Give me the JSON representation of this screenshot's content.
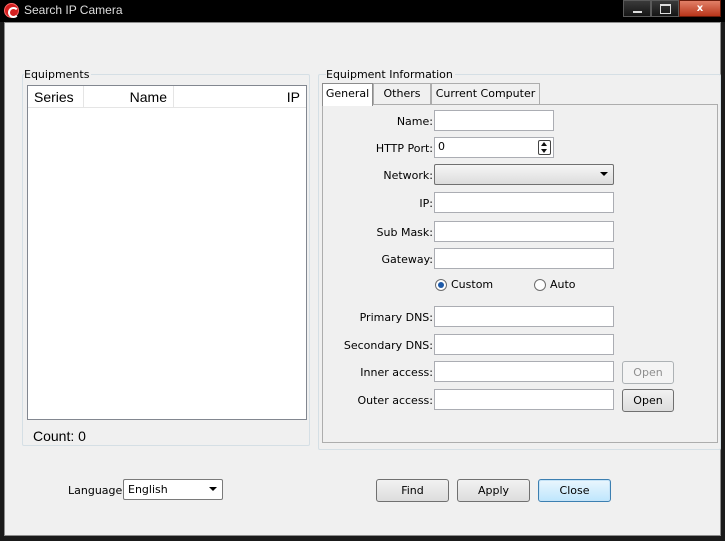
{
  "window": {
    "title": "Search IP Camera",
    "controls": {
      "minimize": "",
      "maximize": "",
      "close": "x"
    }
  },
  "equipments": {
    "group_title": "Equipments",
    "columns": [
      "Series",
      "Name",
      "IP"
    ],
    "rows": [],
    "count_text": "Count: 0"
  },
  "info": {
    "group_title": "Equipment Information",
    "tabs": [
      {
        "label": "General",
        "active": true
      },
      {
        "label": "Others",
        "active": false
      },
      {
        "label": "Current Computer",
        "active": false
      }
    ],
    "fields": {
      "name": {
        "label": "Name:",
        "value": ""
      },
      "http_port": {
        "label": "HTTP Port:",
        "value": "0"
      },
      "network": {
        "label": "Network:",
        "value": ""
      },
      "ip": {
        "label": "IP:",
        "value": ""
      },
      "sub_mask": {
        "label": "Sub Mask:",
        "value": ""
      },
      "gateway": {
        "label": "Gateway:",
        "value": ""
      },
      "primary_dns": {
        "label": "Primary DNS:",
        "value": ""
      },
      "secondary_dns": {
        "label": "Secondary DNS:",
        "value": ""
      },
      "inner_access": {
        "label": "Inner access:",
        "value": ""
      },
      "outer_access": {
        "label": "Outer access:",
        "value": ""
      }
    },
    "dns_mode": {
      "custom_label": "Custom",
      "auto_label": "Auto",
      "selected": "custom"
    },
    "inner_open_label": "Open",
    "outer_open_label": "Open"
  },
  "footer": {
    "language_label": "Language",
    "language_value": "English",
    "find_label": "Find",
    "apply_label": "Apply",
    "close_label": "Close"
  },
  "colors": {
    "accent": "#1e5aa8",
    "titlebar": "#000000",
    "close_button": "#c74a2e"
  }
}
